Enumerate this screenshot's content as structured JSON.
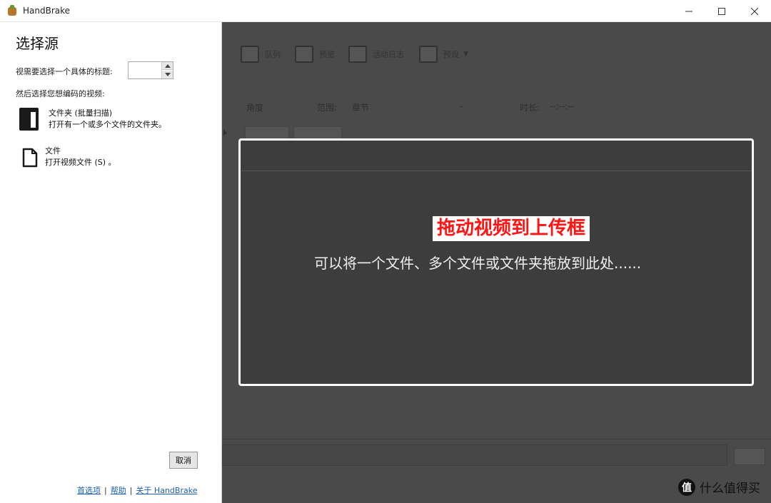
{
  "window": {
    "title": "HandBrake",
    "controls": [
      "minimize",
      "maximize",
      "close"
    ]
  },
  "toolbar": {
    "items": [
      {
        "icon": "queue-icon",
        "label": "队列"
      },
      {
        "icon": "preview-icon",
        "label": "预览"
      },
      {
        "icon": "activity-log-icon",
        "label": "活动日志"
      },
      {
        "icon": "presets-icon",
        "label": "预设"
      }
    ]
  },
  "source_info": {
    "angle_label": "角度",
    "range_label": "范围:",
    "range_value": "章节",
    "range_dash": "-",
    "duration_label": "时长:",
    "duration_value": "--:--:--"
  },
  "source_panel": {
    "title": "选择源",
    "title_question": "视需要选择一个具体的标题:",
    "then_select": "然后选择您想编码的视频:",
    "folder_option": {
      "title": "文件夹 (批量扫描)",
      "description": "打开有一个或多个文件的文件夹。"
    },
    "file_option": {
      "title": "文件",
      "description": "打开视频文件 (S) 。"
    },
    "cancel_label": "取消",
    "links": {
      "preferences": "首选项",
      "help": "帮助",
      "about": "关于 HandBrake",
      "separator": "|"
    }
  },
  "drop_zone": {
    "highlight": "拖动视频到上传框",
    "text": "可以将一个文件、多个文件或文件夹拖放到此处......"
  },
  "watermark": {
    "logo": "值",
    "text": "什么值得买"
  },
  "colors": {
    "overlay_dark": "#4a4a4a",
    "drop_border": "#ffffff",
    "highlight_text": "#ff1414",
    "link": "#1a5fb4"
  }
}
